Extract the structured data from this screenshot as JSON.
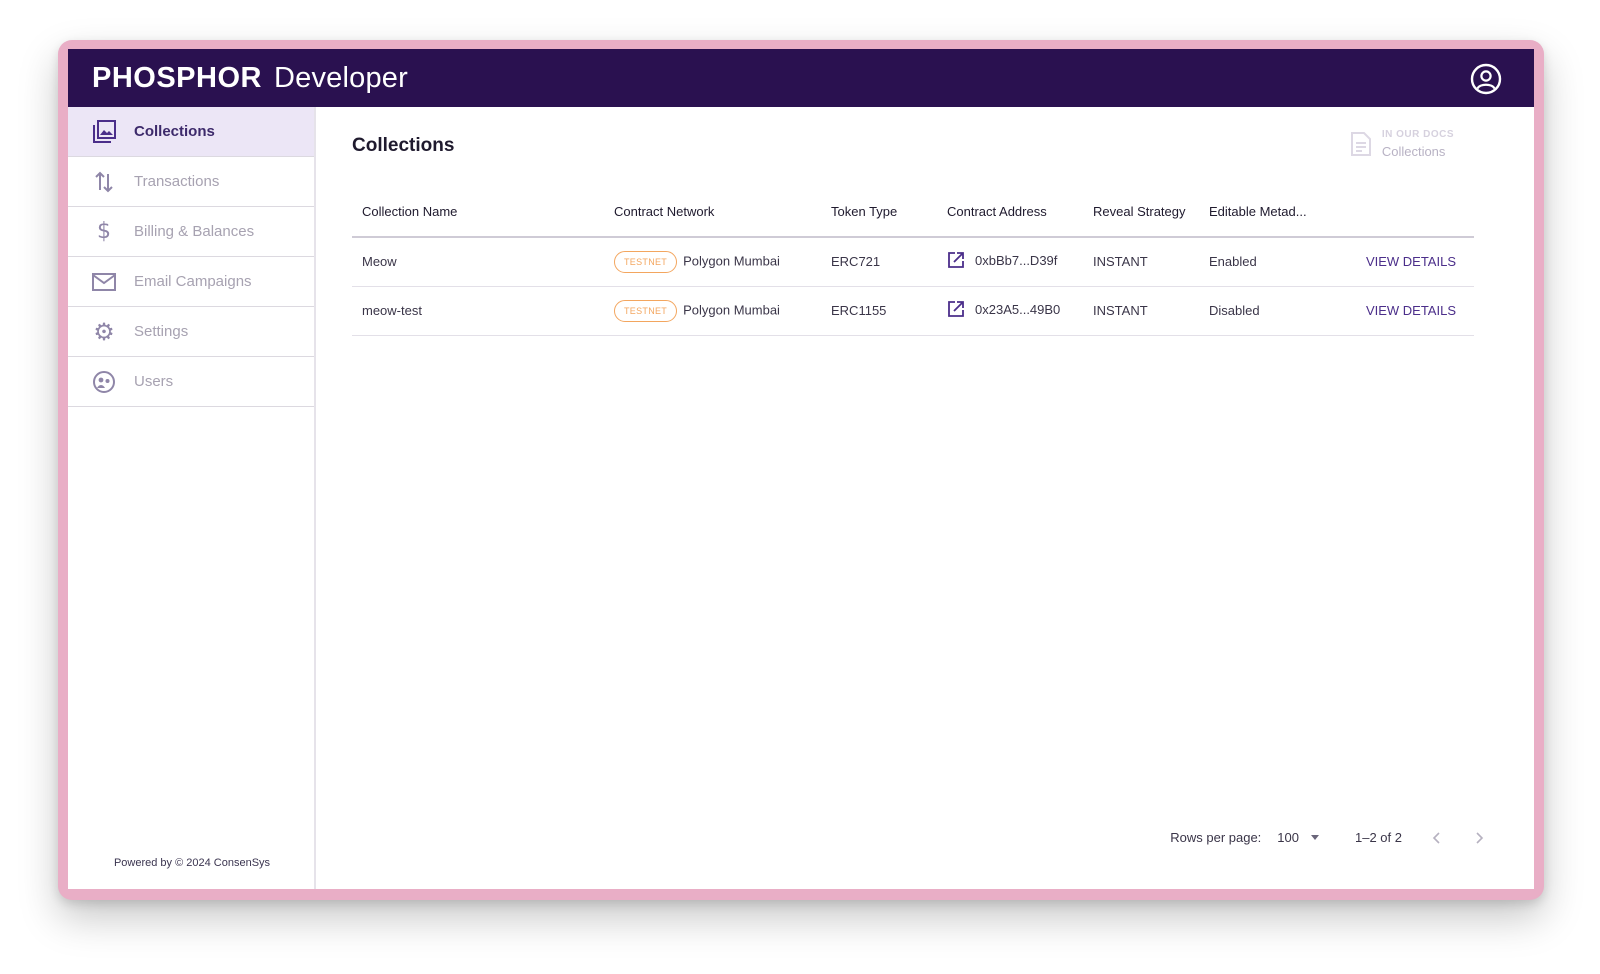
{
  "header": {
    "brand": "PHOSPHOR",
    "subtitle": "Developer",
    "account_icon": "account-circle-icon"
  },
  "sidebar": {
    "items": [
      {
        "label": "Collections",
        "icon": "collections-icon",
        "active": true
      },
      {
        "label": "Transactions",
        "icon": "transactions-icon",
        "active": false
      },
      {
        "label": "Billing & Balances",
        "icon": "dollar-icon",
        "active": false
      },
      {
        "label": "Email Campaigns",
        "icon": "mail-icon",
        "active": false
      },
      {
        "label": "Settings",
        "icon": "gear-icon",
        "active": false
      },
      {
        "label": "Users",
        "icon": "users-icon",
        "active": false
      }
    ],
    "footer": "Powered by © 2024 ConsenSys"
  },
  "main": {
    "title": "Collections",
    "docs": {
      "kicker": "IN OUR DOCS",
      "link": "Collections"
    },
    "table": {
      "columns": [
        "Collection Name",
        "Contract Network",
        "Token Type",
        "Contract Address",
        "Reveal Strategy",
        "Editable Metad..."
      ],
      "rows": [
        {
          "name": "Meow",
          "badge": "TESTNET",
          "network": "Polygon Mumbai",
          "token_type": "ERC721",
          "address": "0xbBb7...D39f",
          "reveal": "INSTANT",
          "editable": "Enabled",
          "action": "VIEW DETAILS"
        },
        {
          "name": "meow-test",
          "badge": "TESTNET",
          "network": "Polygon Mumbai",
          "token_type": "ERC1155",
          "address": "0x23A5...49B0",
          "reveal": "INSTANT",
          "editable": "Disabled",
          "action": "VIEW DETAILS"
        }
      ]
    },
    "pagination": {
      "rows_per_page_label": "Rows per page:",
      "rows_per_page_value": "100",
      "range": "1–2 of 2"
    }
  },
  "colors": {
    "topbar": "#2a1150",
    "accent": "#4b2e8a",
    "testnet": "#f3a65f",
    "frame": "#e9aec6"
  }
}
